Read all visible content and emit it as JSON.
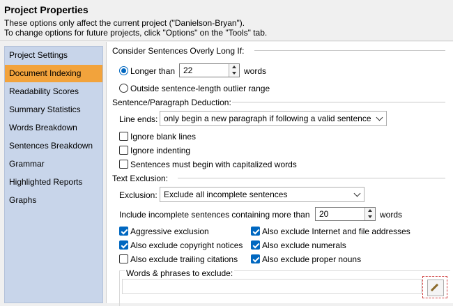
{
  "header": {
    "title": "Project Properties",
    "line1": "These options only affect the current project (\"Danielson-Bryan\").",
    "line2": "To change options for future projects, click \"Options\" on the \"Tools\" tab."
  },
  "sidebar": {
    "items": [
      {
        "label": "Project Settings"
      },
      {
        "label": "Document Indexing"
      },
      {
        "label": "Readability Scores"
      },
      {
        "label": "Summary Statistics"
      },
      {
        "label": "Words Breakdown"
      },
      {
        "label": "Sentences Breakdown"
      },
      {
        "label": "Grammar"
      },
      {
        "label": "Highlighted Reports"
      },
      {
        "label": "Graphs"
      }
    ],
    "selected_index": 1,
    "selected_color": "#f2a33c"
  },
  "long_sentences": {
    "group_label": "Consider Sentences Overly Long If:",
    "longer_than_label": "Longer than",
    "longer_than_value": "22",
    "words_label": "words",
    "outlier_label": "Outside sentence-length outlier range",
    "selected": "longer_than"
  },
  "paragraph": {
    "group_label": "Sentence/Paragraph Deduction:",
    "line_ends_label": "Line ends:",
    "line_ends_value": "only begin a new paragraph if following a valid sentence",
    "ignore_blank_lines": "Ignore blank lines",
    "ignore_indenting": "Ignore indenting",
    "capitalized": "Sentences must begin with capitalized words"
  },
  "exclusion": {
    "group_label": "Text Exclusion:",
    "exclusion_label": "Exclusion:",
    "exclusion_value": "Exclude all incomplete sentences",
    "include_label": "Include incomplete sentences containing more than",
    "include_value": "20",
    "words_label": "words",
    "aggressive": "Aggressive exclusion",
    "copyright": "Also exclude copyright notices",
    "citations": "Also exclude trailing citations",
    "internet": "Also exclude Internet and file addresses",
    "numerals": "Also exclude numerals",
    "proper_nouns": "Also exclude proper nouns",
    "words_phrases_label": "Words & phrases to exclude:",
    "words_phrases_value": ""
  },
  "colors": {
    "accent": "#0067c0",
    "sidebar_bg": "#c8d5ea"
  }
}
